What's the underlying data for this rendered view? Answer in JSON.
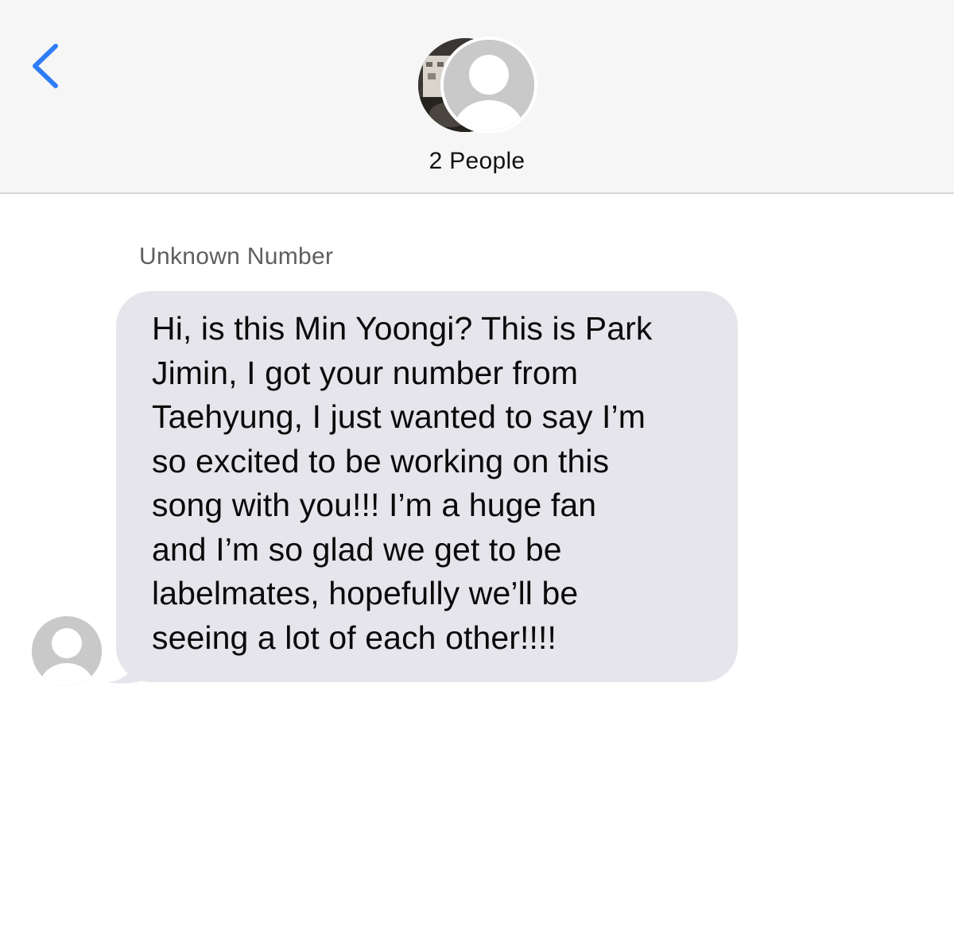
{
  "header": {
    "title": "2 People",
    "back_icon": "chevron-left-icon",
    "accent_color": "#2f7cf6"
  },
  "conversation": {
    "sender_label": "Unknown Number",
    "messages": [
      {
        "direction": "incoming",
        "text": "Hi, is this Min Yoongi? This is Park\nJimin, I got your number from\nTaehyung, I just wanted to say I’m\nso excited to be working on this\nsong with you!!! I’m a huge fan\nand I’m so glad we get to be\nlabelmates, hopefully we’ll be\nseeing a lot of each other!!!!",
        "bubble_color": "#e6e5eb"
      }
    ]
  }
}
